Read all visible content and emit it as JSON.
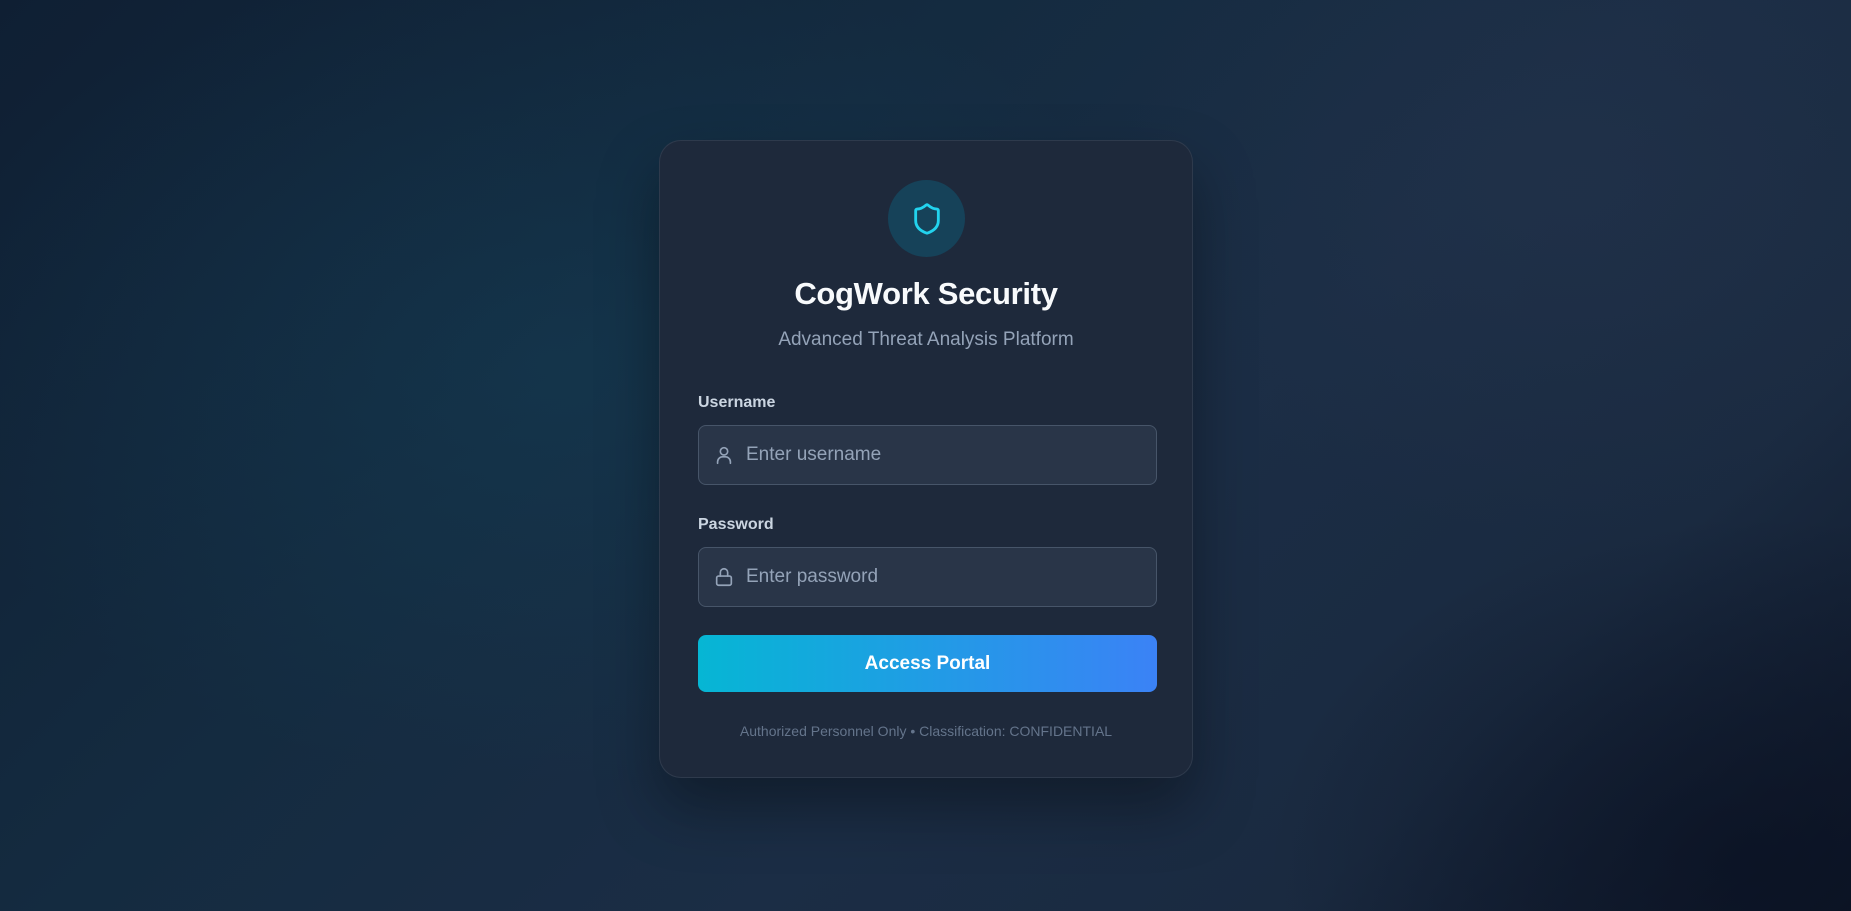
{
  "brand": {
    "title": "CogWork Security",
    "subtitle": "Advanced Threat Analysis Platform",
    "logo_icon": "shield-icon",
    "accent_color": "#22d3ee"
  },
  "form": {
    "username": {
      "label": "Username",
      "placeholder": "Enter username",
      "value": "",
      "icon": "user-icon"
    },
    "password": {
      "label": "Password",
      "placeholder": "Enter password",
      "value": "",
      "icon": "lock-icon"
    },
    "submit_label": "Access Portal",
    "submit_gradient": [
      "#06b6d4",
      "#3b82f6"
    ]
  },
  "footer": {
    "notice": "Authorized Personnel Only • Classification: CONFIDENTIAL"
  }
}
